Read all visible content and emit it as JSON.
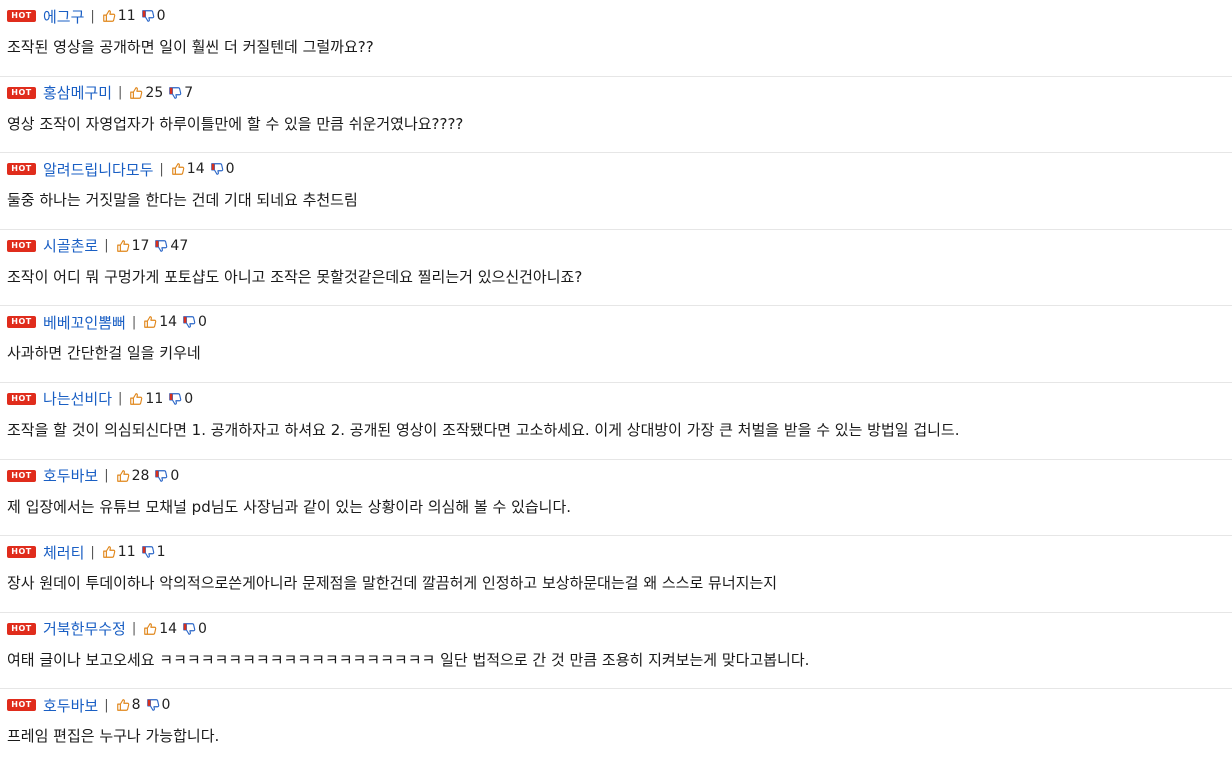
{
  "badge_label": "HOT",
  "colors": {
    "badge_bg": "#e02c1c",
    "nickname": "#1a5fc4"
  },
  "icons": {
    "like": "thumbs-up-icon",
    "dislike": "thumbs-down-icon"
  },
  "comments": [
    {
      "nickname": "에그구",
      "likes": "11",
      "dislikes": "0",
      "text": "조작된 영상을 공개하면 일이 훨씬 더 커질텐데 그럴까요??"
    },
    {
      "nickname": "홍삼메구미",
      "likes": "25",
      "dislikes": "7",
      "text": "영상 조작이 자영업자가 하루이틀만에 할 수 있을 만큼 쉬운거였나요????"
    },
    {
      "nickname": "알려드립니다모두",
      "likes": "14",
      "dislikes": "0",
      "text": "둘중 하나는 거짓말을 한다는 건데 기대 되네요 추천드림"
    },
    {
      "nickname": "시골촌로",
      "likes": "17",
      "dislikes": "47",
      "text": "조작이 어디 뭐 구멍가게 포토샵도 아니고 조작은 못할것같은데요 찔리는거 있으신건아니죠?"
    },
    {
      "nickname": "베베꼬인뽐뻐",
      "likes": "14",
      "dislikes": "0",
      "text": "사과하면 간단한걸 일을 키우네"
    },
    {
      "nickname": "나는선비다",
      "likes": "11",
      "dislikes": "0",
      "text": "조작을 할 것이 의심되신다면 1. 공개하자고 하셔요 2. 공개된 영상이 조작됐다면 고소하세요. 이게 상대방이 가장 큰 처벌을 받을 수 있는 방법일 겁니드."
    },
    {
      "nickname": "호두바보",
      "likes": "28",
      "dislikes": "0",
      "text": "제 입장에서는 유튜브 모채널 pd님도 사장님과 같이 있는 상황이라 의심해 볼 수 있습니다."
    },
    {
      "nickname": "체러티",
      "likes": "11",
      "dislikes": "1",
      "text": "장사 원데이 투데이하나 악의적으로쓴게아니라 문제점을 말한건데 깔끔허게 인정하고 보상하문대는걸 왜 스스로 뮤너지는지"
    },
    {
      "nickname": "거북한무수정",
      "likes": "14",
      "dislikes": "0",
      "text": "여태 글이나 보고오세요 ㅋㅋㅋㅋㅋㅋㅋㅋㅋㅋㅋㅋㅋㅋㅋㅋㅋㅋㅋㅋ 일단 법적으로 간 것 만큼 조용히 지켜보는게 맞다고봅니다."
    },
    {
      "nickname": "호두바보",
      "likes": "8",
      "dislikes": "0",
      "text": "프레임 편집은 누구나 가능합니다."
    }
  ]
}
